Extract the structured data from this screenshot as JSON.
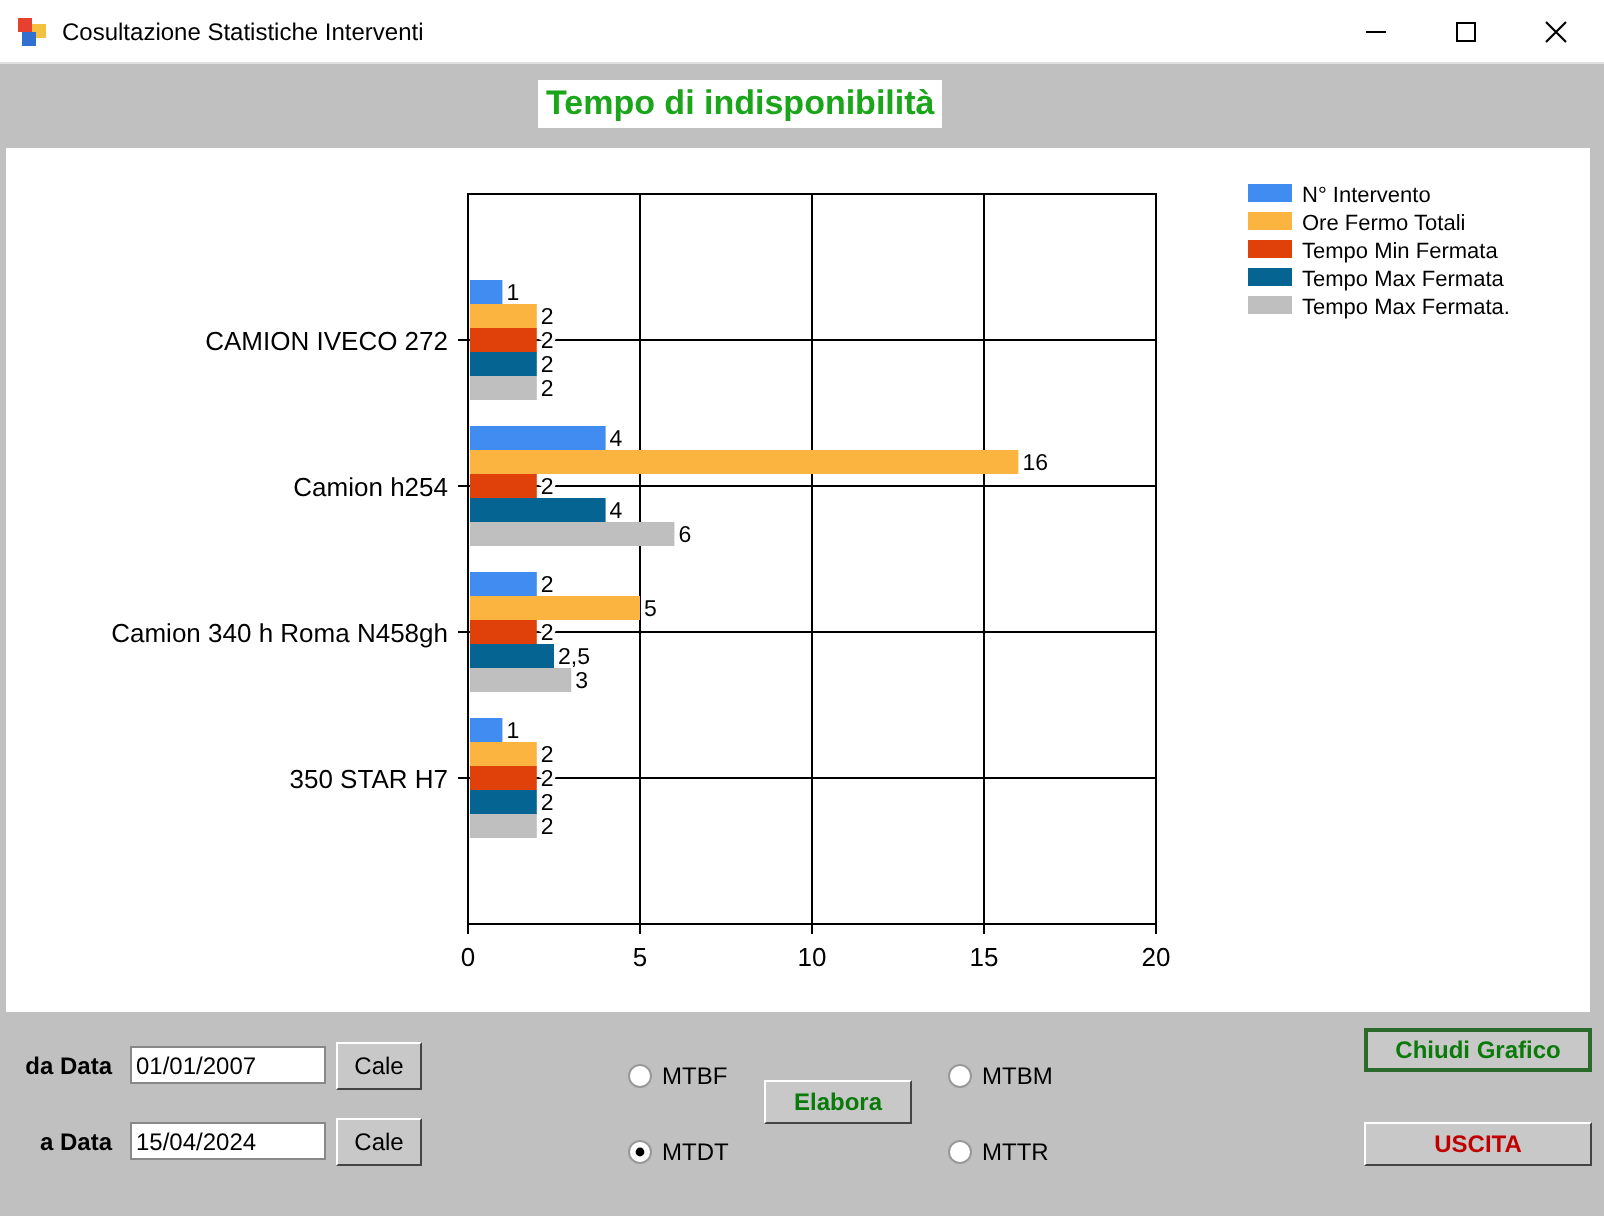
{
  "window": {
    "title": "Cosultazione Statistiche Interventi"
  },
  "chart_title": "Tempo di indisponibilità",
  "chart": {
    "chart_data": {
      "type": "bar",
      "orientation": "horizontal",
      "categories": [
        "CAMION IVECO 272",
        "Camion h254",
        "Camion 340 h Roma N458gh",
        "350 STAR H7"
      ],
      "xlim": [
        0,
        20
      ],
      "xticks": [
        0,
        5,
        10,
        15,
        20
      ],
      "data_labels": true,
      "grid": true,
      "legend": true,
      "series": [
        {
          "name": "N° Intervento",
          "color": "#418cf0",
          "values": [
            1,
            4,
            2,
            1
          ],
          "value_labels": [
            "1",
            "4",
            "2",
            "1"
          ]
        },
        {
          "name": "Ore Fermo Totali",
          "color": "#fcb441",
          "values": [
            2,
            16,
            5,
            2
          ],
          "value_labels": [
            "2",
            "16",
            "5",
            "2"
          ]
        },
        {
          "name": "Tempo Min Fermata",
          "color": "#e0400a",
          "values": [
            2,
            2,
            2,
            2
          ],
          "value_labels": [
            "2",
            "2",
            "2",
            "2"
          ]
        },
        {
          "name": "Tempo Max Fermata",
          "color": "#056492",
          "values": [
            2,
            4,
            2.5,
            2
          ],
          "value_labels": [
            "2",
            "4",
            "2,5",
            "2"
          ]
        },
        {
          "name": "Tempo Max Fermata.",
          "color": "#bfbfbf",
          "values": [
            2,
            6,
            3,
            2
          ],
          "value_labels": [
            "2",
            "6",
            "3",
            "2"
          ]
        }
      ]
    }
  },
  "date_fields": [
    {
      "label": "da Data",
      "value": "01/01/2007",
      "button": "Cale"
    },
    {
      "label": "a Data",
      "value": "15/04/2024",
      "button": "Cale"
    }
  ],
  "radios": [
    {
      "label": "MTBF",
      "selected": false
    },
    {
      "label": "MTDT",
      "selected": true
    },
    {
      "label": "MTBM",
      "selected": false
    },
    {
      "label": "MTTR",
      "selected": false
    }
  ],
  "elabora_button": "Elabora",
  "close_chart_button": "Chiudi Grafico",
  "exit_button": "USCITA"
}
